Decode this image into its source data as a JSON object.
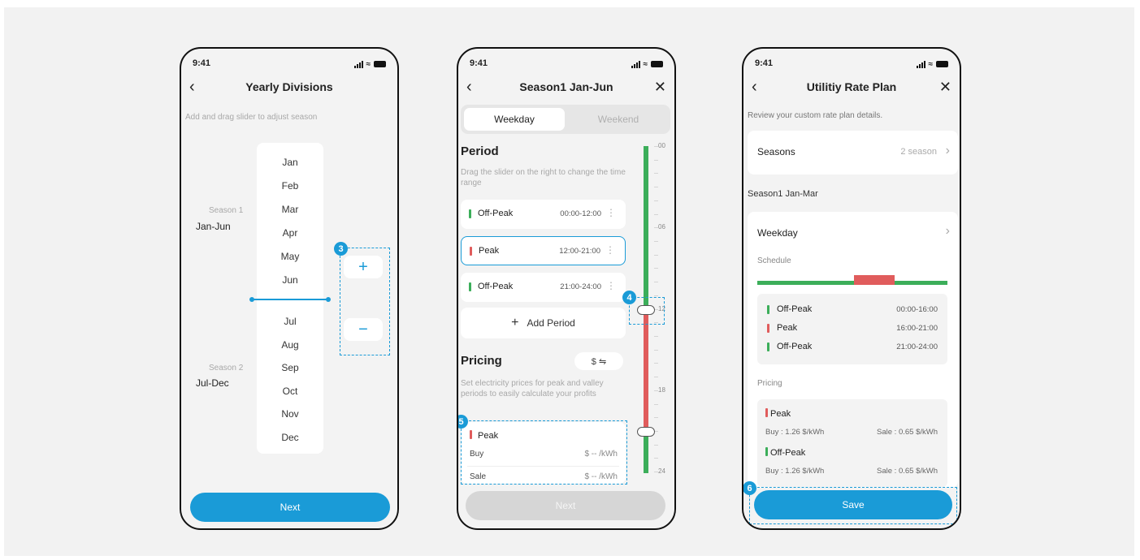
{
  "status_time": "9:41",
  "phone1": {
    "title": "Yearly Divisions",
    "hint": "Add and drag slider to adjust season",
    "months_top": [
      "Jan",
      "Feb",
      "Mar",
      "Apr",
      "May",
      "Jun"
    ],
    "months_bottom": [
      "Jul",
      "Aug",
      "Sep",
      "Oct",
      "Nov",
      "Dec"
    ],
    "season1_label": "Season 1",
    "season1_range": "Jan-Jun",
    "season2_label": "Season 2",
    "season2_range": "Jul-Dec",
    "add_symbol": "+",
    "remove_symbol": "−",
    "badge": "3",
    "next_label": "Next"
  },
  "phone2": {
    "title": "Season1 Jan-Jun",
    "tab_weekday": "Weekday",
    "tab_weekend": "Weekend",
    "period_heading": "Period",
    "period_hint": "Drag the slider on the right to change the time range",
    "periods": [
      {
        "name": "Off-Peak",
        "time": "00:00-12:00",
        "color": "#3cae5a"
      },
      {
        "name": "Peak",
        "time": "12:00-21:00",
        "color": "#e05c5c"
      },
      {
        "name": "Off-Peak",
        "time": "21:00-24:00",
        "color": "#3cae5a"
      }
    ],
    "add_period": "Add Period",
    "pricing_heading": "Pricing",
    "currency_toggle": "$ ⇋",
    "pricing_hint": "Set electricity prices for peak and valley periods to easily calculate your profits",
    "peak_label": "Peak",
    "buy_label": "Buy",
    "buy_value": "$ -- /kWh",
    "sale_label": "Sale",
    "sale_value": "$ -- /kWh",
    "hour_ticks": [
      "00",
      "06",
      "12",
      "18",
      "24"
    ],
    "badge4": "4",
    "badge5": "5",
    "next_label": "Next"
  },
  "phone3": {
    "title": "Utilitiy Rate Plan",
    "hint": "Review your custom rate plan details.",
    "seasons_label": "Seasons",
    "seasons_value": "2 season",
    "section_label": "Season1 Jan-Mar",
    "weekday_label": "Weekday",
    "schedule_label": "Schedule",
    "schedule_rows": [
      {
        "name": "Off-Peak",
        "time": "00:00-16:00",
        "color": "#3cae5a"
      },
      {
        "name": "Peak",
        "time": "16:00-21:00",
        "color": "#e05c5c"
      },
      {
        "name": "Off-Peak",
        "time": "21:00-24:00",
        "color": "#3cae5a"
      }
    ],
    "pricing_label": "Pricing",
    "peak_label": "Peak",
    "peak_buy": "Buy : 1.26 $/kWh",
    "peak_sale": "Sale : 0.65 $/kWh",
    "offpeak_label": "Off-Peak",
    "offpeak_buy": "Buy : 1.26 $/kWh",
    "offpeak_sale": "Sale : 0.65 $/kWh",
    "badge": "6",
    "save_label": "Save"
  },
  "colors": {
    "accent": "#1a9bd7",
    "offpeak": "#3cae5a",
    "peak": "#e05c5c"
  }
}
